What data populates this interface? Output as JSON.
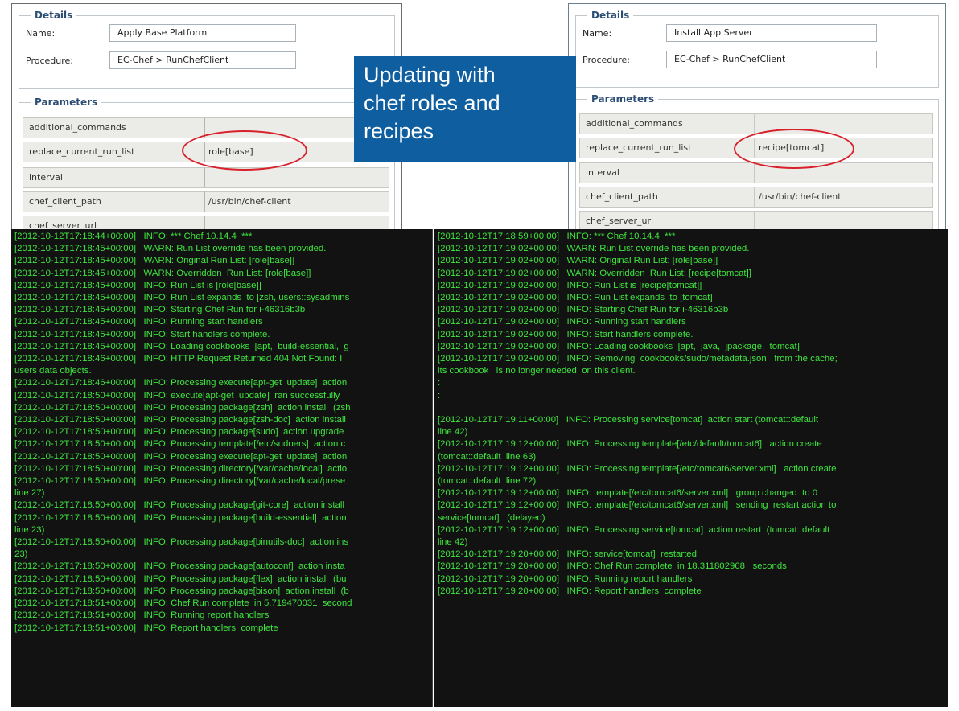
{
  "left_panel": {
    "details_legend": "Details",
    "name_label": "Name:",
    "name_value": "Apply Base Platform",
    "procedure_label": "Procedure:",
    "procedure_value": "EC-Chef > RunChefClient",
    "parameters_legend": "Parameters",
    "params": [
      {
        "key": "additional_commands",
        "value": ""
      },
      {
        "key": "replace_current_run_list",
        "value": "role[base]"
      },
      {
        "key": "interval",
        "value": ""
      },
      {
        "key": "chef_client_path",
        "value": "/usr/bin/chef-client"
      },
      {
        "key": "chef_server_url",
        "value": ""
      }
    ]
  },
  "right_panel": {
    "details_legend": "Details",
    "name_label": "Name:",
    "name_value": "Install App Server",
    "procedure_label": "Procedure:",
    "procedure_value": "EC-Chef > RunChefClient",
    "parameters_legend": "Parameters",
    "params": [
      {
        "key": "additional_commands",
        "value": ""
      },
      {
        "key": "replace_current_run_list",
        "value": "recipe[tomcat]"
      },
      {
        "key": "interval",
        "value": ""
      },
      {
        "key": "chef_client_path",
        "value": "/usr/bin/chef-client"
      },
      {
        "key": "chef_server_url",
        "value": ""
      }
    ]
  },
  "callout": {
    "lines": [
      "Updating with",
      "chef roles and",
      "recipes"
    ]
  },
  "colors": {
    "callout_bg": "#0f5fa0",
    "highlight_ring": "#d8202a",
    "console_bg": "#121212",
    "console_text": "#3ee43e",
    "legend_text": "#2c4d75"
  },
  "console_left": {
    "lines": [
      "[2012-10-12T17:18:44+00:00]   INFO: *** Chef 10.14.4  ***",
      "[2012-10-12T17:18:45+00:00]   WARN: Run List override has been provided.",
      "[2012-10-12T17:18:45+00:00]   WARN: Original Run List: [role[base]]",
      "[2012-10-12T17:18:45+00:00]   WARN: Overridden  Run List: [role[base]]",
      "[2012-10-12T17:18:45+00:00]   INFO: Run List is [role[base]]",
      "[2012-10-12T17:18:45+00:00]   INFO: Run List expands  to [zsh, users::sysadmins",
      "[2012-10-12T17:18:45+00:00]   INFO: Starting Chef Run for i-46316b3b",
      "[2012-10-12T17:18:45+00:00]   INFO: Running start handlers",
      "[2012-10-12T17:18:45+00:00]   INFO: Start handlers complete.",
      "[2012-10-12T17:18:45+00:00]   INFO: Loading cookbooks  [apt,  build-essential,  g",
      "[2012-10-12T17:18:46+00:00]   INFO: HTTP Request Returned 404 Not Found: I",
      "users data objects.",
      "[2012-10-12T17:18:46+00:00]   INFO: Processing execute[apt-get  update]  action",
      "[2012-10-12T17:18:50+00:00]   INFO: execute[apt-get  update]  ran successfully",
      "[2012-10-12T17:18:50+00:00]   INFO: Processing package[zsh]  action install  (zsh",
      "[2012-10-12T17:18:50+00:00]   INFO: Processing package[zsh-doc]  action install",
      "[2012-10-12T17:18:50+00:00]   INFO: Processing package[sudo]  action upgrade",
      "[2012-10-12T17:18:50+00:00]   INFO: Processing template[/etc/sudoers]  action c",
      "[2012-10-12T17:18:50+00:00]   INFO: Processing execute[apt-get  update]  action",
      "[2012-10-12T17:18:50+00:00]   INFO: Processing directory[/var/cache/local]  actio",
      "[2012-10-12T17:18:50+00:00]   INFO: Processing directory[/var/cache/local/prese",
      "line 27)",
      "[2012-10-12T17:18:50+00:00]   INFO: Processing package[git-core]  action install",
      "[2012-10-12T17:18:50+00:00]   INFO: Processing package[build-essential]  action",
      "line 23)",
      "[2012-10-12T17:18:50+00:00]   INFO: Processing package[binutils-doc]  action ins",
      "23)",
      "[2012-10-12T17:18:50+00:00]   INFO: Processing package[autoconf]  action insta",
      "[2012-10-12T17:18:50+00:00]   INFO: Processing package[flex]  action install  (bu",
      "[2012-10-12T17:18:50+00:00]   INFO: Processing package[bison]  action install  (b",
      "[2012-10-12T17:18:51+00:00]   INFO: Chef Run complete  in 5.719470031  second",
      "[2012-10-12T17:18:51+00:00]   INFO: Running report handlers",
      "[2012-10-12T17:18:51+00:00]   INFO: Report handlers  complete"
    ]
  },
  "console_right": {
    "lines": [
      "[2012-10-12T17:18:59+00:00]   INFO: *** Chef 10.14.4  ***",
      "[2012-10-12T17:19:02+00:00]   WARN: Run List override has been provided.",
      "[2012-10-12T17:19:02+00:00]   WARN: Original Run List: [role[base]]",
      "[2012-10-12T17:19:02+00:00]   WARN: Overridden  Run List: [recipe[tomcat]]",
      "[2012-10-12T17:19:02+00:00]   INFO: Run List is [recipe[tomcat]]",
      "[2012-10-12T17:19:02+00:00]   INFO: Run List expands  to [tomcat]",
      "[2012-10-12T17:19:02+00:00]   INFO: Starting Chef Run for i-46316b3b",
      "[2012-10-12T17:19:02+00:00]   INFO: Running start handlers",
      "[2012-10-12T17:19:02+00:00]   INFO: Start handlers complete.",
      "[2012-10-12T17:19:02+00:00]   INFO: Loading cookbooks  [apt,  java,  jpackage,  tomcat]",
      "[2012-10-12T17:19:02+00:00]   INFO: Removing  cookbooks/sudo/metadata.json   from the cache;",
      "its cookbook   is no longer needed  on this client.",
      ":",
      ":",
      "",
      "[2012-10-12T17:19:11+00:00]   INFO: Processing service[tomcat]  action start (tomcat::default",
      "line 42)",
      "[2012-10-12T17:19:12+00:00]   INFO: Processing template[/etc/default/tomcat6]   action create",
      "(tomcat::default  line 63)",
      "[2012-10-12T17:19:12+00:00]   INFO: Processing template[/etc/tomcat6/server.xml]   action create",
      "(tomcat::default  line 72)",
      "[2012-10-12T17:19:12+00:00]   INFO: template[/etc/tomcat6/server.xml]   group changed  to 0",
      "[2012-10-12T17:19:12+00:00]   INFO: template[/etc/tomcat6/server.xml]   sending  restart action to",
      "service[tomcat]   (delayed)",
      "[2012-10-12T17:19:12+00:00]   INFO: Processing service[tomcat]  action restart  (tomcat::default",
      "line 42)",
      "[2012-10-12T17:19:20+00:00]   INFO: service[tomcat]  restarted",
      "[2012-10-12T17:19:20+00:00]   INFO: Chef Run complete  in 18.311802968   seconds",
      "[2012-10-12T17:19:20+00:00]   INFO: Running report handlers",
      "[2012-10-12T17:19:20+00:00]   INFO: Report handlers  complete"
    ]
  }
}
